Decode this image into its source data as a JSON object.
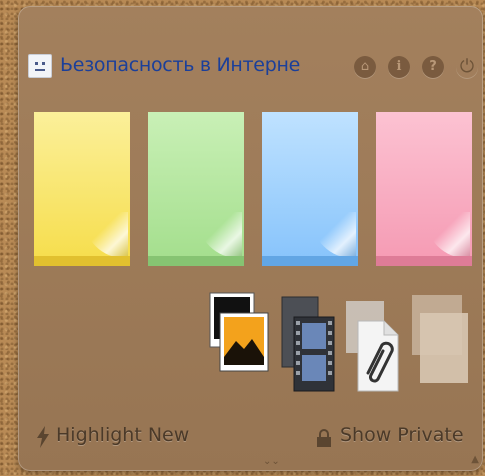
{
  "header": {
    "title": "Ьезопасность в Интерне",
    "buttons": [
      {
        "name": "home-icon",
        "glyph": "⌂"
      },
      {
        "name": "info-icon",
        "glyph": "i"
      },
      {
        "name": "help-icon",
        "glyph": "?"
      },
      {
        "name": "power-icon",
        "glyph": "⏻"
      }
    ]
  },
  "notes": [
    {
      "name": "sticky-note-yellow",
      "color": "#fbe86a",
      "shade": "#e8c83a"
    },
    {
      "name": "sticky-note-green",
      "color": "#b9eaa6",
      "shade": "#8fcf7d"
    },
    {
      "name": "sticky-note-blue",
      "color": "#a9d6ff",
      "shade": "#6fb4ee"
    },
    {
      "name": "sticky-note-pink",
      "color": "#fbb0c4",
      "shade": "#e87d9a"
    }
  ],
  "tools": [
    "photo-icon",
    "video-icon",
    "attachment-icon",
    "blank-note-icon"
  ],
  "footer": {
    "highlight_label": "Highlight New",
    "private_label": "Show Private"
  },
  "colors": {
    "panel": "#9c7a57",
    "title": "#1b3f9a",
    "footer_text": "#4b3a29"
  }
}
